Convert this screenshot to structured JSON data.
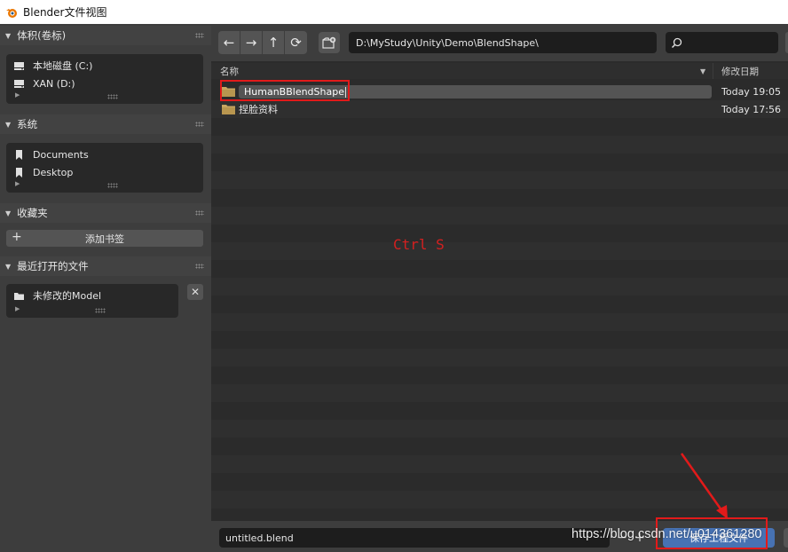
{
  "window": {
    "title": "Blender文件视图"
  },
  "sidebar": {
    "volumes": {
      "header": "体积(卷标)",
      "items": [
        {
          "label": "本地磁盘 (C:)",
          "icon": "drive-icon"
        },
        {
          "label": "XAN (D:)",
          "icon": "drive-icon"
        }
      ]
    },
    "system": {
      "header": "系统",
      "items": [
        {
          "label": "Documents",
          "icon": "bookmark-icon"
        },
        {
          "label": "Desktop",
          "icon": "bookmark-icon"
        }
      ]
    },
    "bookmarks": {
      "header": "收藏夹",
      "add_label": "添加书签"
    },
    "recent": {
      "header": "最近打开的文件",
      "items": [
        {
          "label": "未修改的Model",
          "icon": "folder-icon"
        }
      ]
    }
  },
  "toolbar": {
    "path": "D:\\MyStudy\\Unity\\Demo\\BlendShape\\",
    "search_value": ""
  },
  "columns": {
    "name": "名称",
    "date": "修改日期"
  },
  "files": [
    {
      "name": "HumanBBlendShape",
      "date": "Today 19:05",
      "editing": true
    },
    {
      "name": "捏脸资料",
      "date": "Today 17:56",
      "editing": false
    }
  ],
  "annotation": {
    "text": "Ctrl S",
    "color": "#d42020"
  },
  "bottom": {
    "filename": "untitled.blend",
    "minus": "−",
    "plus": "+",
    "save_label": "保存工程文件"
  },
  "watermark": "https://blog.csdn.net/u014361280",
  "colors": {
    "accent": "#4772b3",
    "highlight_red": "#e21a1a",
    "folder": "#c8a560"
  }
}
